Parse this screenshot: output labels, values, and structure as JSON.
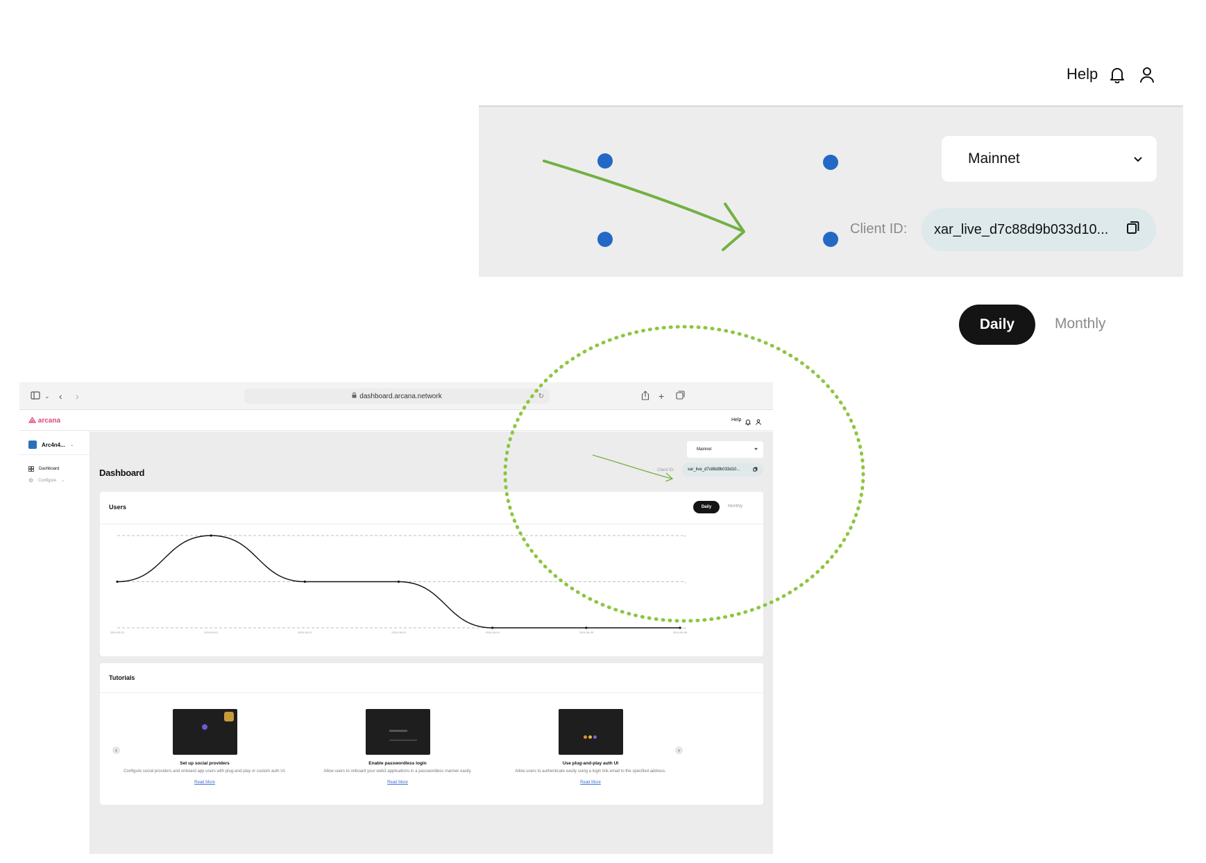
{
  "zoom": {
    "help_label": "Help",
    "network_value": "Mainnet",
    "client_id_label": "Client ID:",
    "client_id_value": "xar_live_d7c88d9b033d10...",
    "tabs": {
      "daily": "Daily",
      "monthly": "Monthly"
    }
  },
  "browser": {
    "url": "dashboard.arcana.network",
    "app": {
      "logo_text": "arcana",
      "help_label": "Help",
      "app_name": "Arc4n4...",
      "sidebar": [
        {
          "label": "Dashboard",
          "icon": "grid-icon"
        },
        {
          "label": "Configure",
          "icon": "gear-icon"
        }
      ],
      "page_title": "Dashboard",
      "network_value": "Mainnet",
      "client_id_label": "Client ID:",
      "client_id_value": "xar_live_d7c88d9b033d10...",
      "users_card": {
        "title": "Users",
        "tabs": {
          "daily": "Daily",
          "monthly": "Monthly"
        }
      },
      "tutorials": {
        "title": "Tutorials",
        "items": [
          {
            "title": "Set up social providers",
            "description": "Configure social providers and onboard app users with plug-and-play or custom auth UI.",
            "link": "Read More"
          },
          {
            "title": "Enable passwordless login",
            "description": "Allow users to onboard your web3 applications in a passwordless manner easily.",
            "link": "Read More"
          },
          {
            "title": "Use plug-and-play auth UI",
            "description": "Allow users to authenticate easily using a login link email to the specified address.",
            "link": "Read More"
          }
        ]
      }
    }
  },
  "chart_data": {
    "type": "line",
    "x": [
      "2024-05-31",
      "2024-06-01",
      "2024-06-02",
      "2024-06-03",
      "2024-06-04",
      "2024-06-05",
      "2024-06-06"
    ],
    "series": [
      {
        "values": [
          1,
          2,
          1,
          1,
          0,
          0,
          0
        ]
      }
    ],
    "ylim": [
      0,
      2
    ],
    "yticks": [
      "0",
      "1",
      "2"
    ],
    "grid": true,
    "line_color": "#111111"
  },
  "colors": {
    "accent_green": "#72b043",
    "handle_blue": "#2468c6",
    "brand_pink": "#e0457b",
    "dark_pill": "#141414"
  }
}
